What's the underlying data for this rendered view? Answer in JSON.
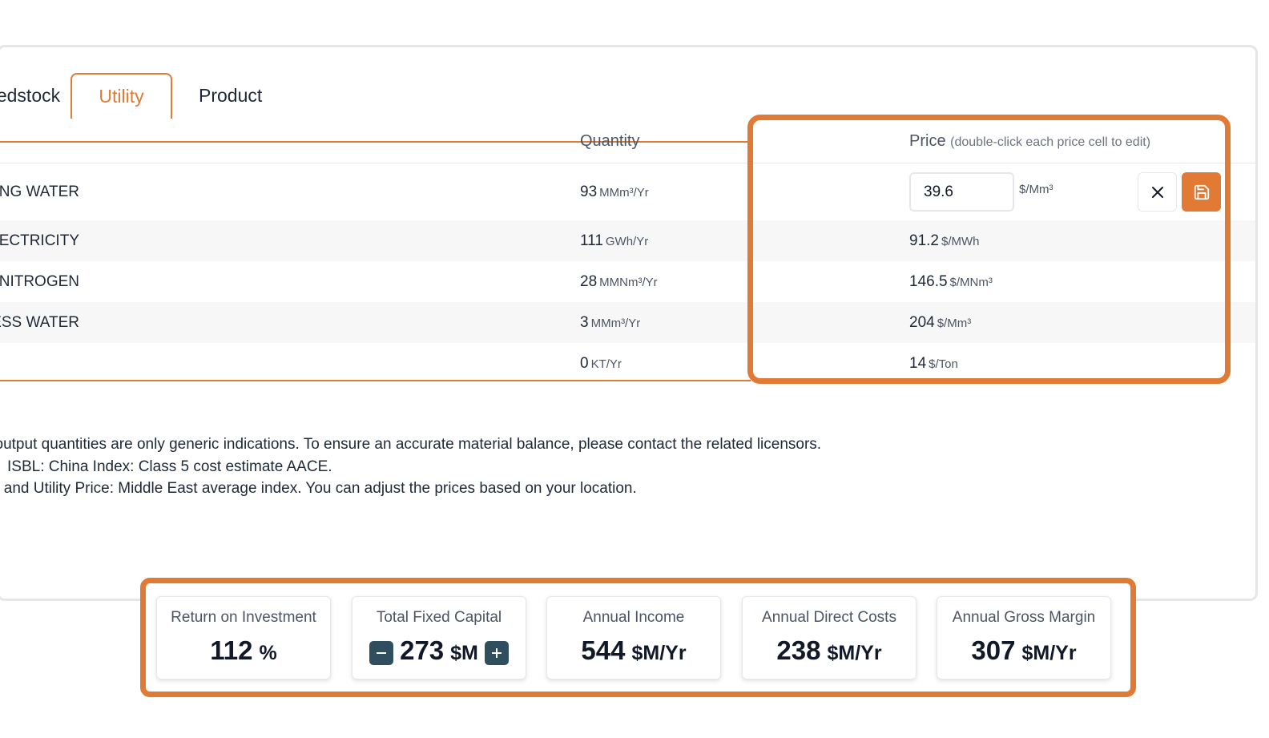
{
  "tabs": [
    {
      "label": "Feedstock"
    },
    {
      "label": "Utility"
    },
    {
      "label": "Product"
    }
  ],
  "table": {
    "headers": {
      "quantity": "Quantity",
      "price": "Price",
      "price_hint": "(double-click each price cell to edit)"
    },
    "rows": [
      {
        "name": "COOLING WATER",
        "qty": "93",
        "qty_unit": "MMm³/Yr",
        "price": "39.6",
        "price_unit": "$/Mm³"
      },
      {
        "name": "ELECTRICITY",
        "qty": "111",
        "qty_unit": "GWh/Yr",
        "price": "91.2",
        "price_unit": "$/MWh"
      },
      {
        "name": "NITROGEN",
        "qty": "28",
        "qty_unit": "MMNm³/Yr",
        "price": "146.5",
        "price_unit": "$/MNm³"
      },
      {
        "name": "PROCESS WATER",
        "qty": "3",
        "qty_unit": "MMm³/Yr",
        "price": "204",
        "price_unit": "$/Mm³"
      },
      {
        "name": "",
        "qty": "0",
        "qty_unit": "KT/Yr",
        "price": "14",
        "price_unit": "$/Ton"
      }
    ]
  },
  "notes": [
    "Input and output quantities are only generic indications. To ensure an accurate material balance, please contact the related licensors.",
    "ISBL: China Index: Class 5 cost estimate AACE.",
    "Product and Utility Price: Middle East average index. You can adjust the prices based on your location."
  ],
  "kpis": [
    {
      "label": "Return on Investment",
      "value": "112",
      "unit": "%"
    },
    {
      "label": "Total Fixed Capital",
      "value": "273",
      "unit": "$M"
    },
    {
      "label": "Annual Income",
      "value": "544",
      "unit": "$M/Yr"
    },
    {
      "label": "Annual Direct Costs",
      "value": "238",
      "unit": "$M/Yr"
    },
    {
      "label": "Annual Gross Margin",
      "value": "307",
      "unit": "$M/Yr"
    }
  ],
  "colors": {
    "accent": "#e07a35",
    "stepper": "#2f4f5e"
  },
  "icons": {
    "cancel": "close-icon",
    "save": "save-icon",
    "decrease": "minus-icon",
    "increase": "plus-icon"
  }
}
